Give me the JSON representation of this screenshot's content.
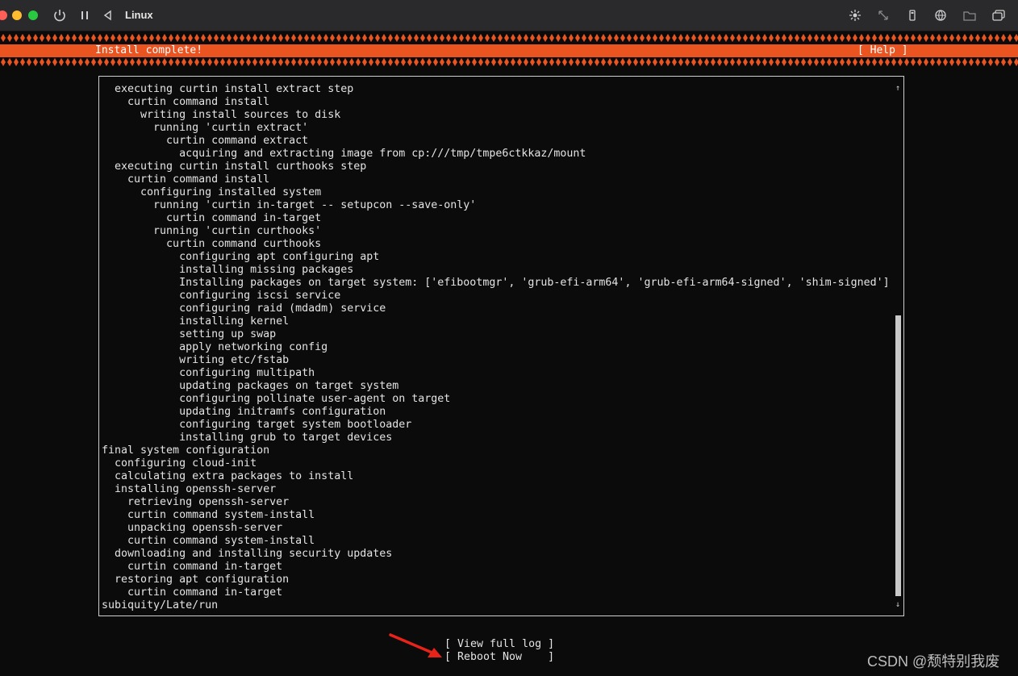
{
  "window": {
    "title": "Linux",
    "toolbar_icons": [
      "power-icon",
      "pause-icon",
      "back-icon",
      "brightness-icon",
      "resize-icon",
      "usb-icon",
      "network-icon",
      "shared-folder-icon",
      "window-icon"
    ]
  },
  "installer": {
    "header_title": "Install complete!",
    "help_label": "[ Help ]",
    "accent_color": "#e95420"
  },
  "log": {
    "lines": [
      "  executing curtin install extract step",
      "    curtin command install",
      "      writing install sources to disk",
      "        running 'curtin extract'",
      "          curtin command extract",
      "            acquiring and extracting image from cp:///tmp/tmpe6ctkkaz/mount",
      "  executing curtin install curthooks step",
      "    curtin command install",
      "      configuring installed system",
      "        running 'curtin in-target -- setupcon --save-only'",
      "          curtin command in-target",
      "        running 'curtin curthooks'",
      "          curtin command curthooks",
      "            configuring apt configuring apt",
      "            installing missing packages",
      "            Installing packages on target system: ['efibootmgr', 'grub-efi-arm64', 'grub-efi-arm64-signed', 'shim-signed']",
      "            configuring iscsi service",
      "            configuring raid (mdadm) service",
      "            installing kernel",
      "            setting up swap",
      "            apply networking config",
      "            writing etc/fstab",
      "            configuring multipath",
      "            updating packages on target system",
      "            configuring pollinate user-agent on target",
      "            updating initramfs configuration",
      "            configuring target system bootloader",
      "            installing grub to target devices",
      "final system configuration",
      "  configuring cloud-init",
      "  calculating extra packages to install",
      "  installing openssh-server",
      "    retrieving openssh-server",
      "    curtin command system-install",
      "    unpacking openssh-server",
      "    curtin command system-install",
      "  downloading and installing security updates",
      "    curtin command in-target",
      "  restoring apt configuration",
      "    curtin command in-target",
      "subiquity/Late/run"
    ],
    "scroll_up_glyph": "↑",
    "scroll_down_glyph": "↓"
  },
  "actions": {
    "view_full_log": "[ View full log ]",
    "reboot_now": "[ Reboot Now    ]"
  },
  "watermark": "CSDN @颓特别我废"
}
